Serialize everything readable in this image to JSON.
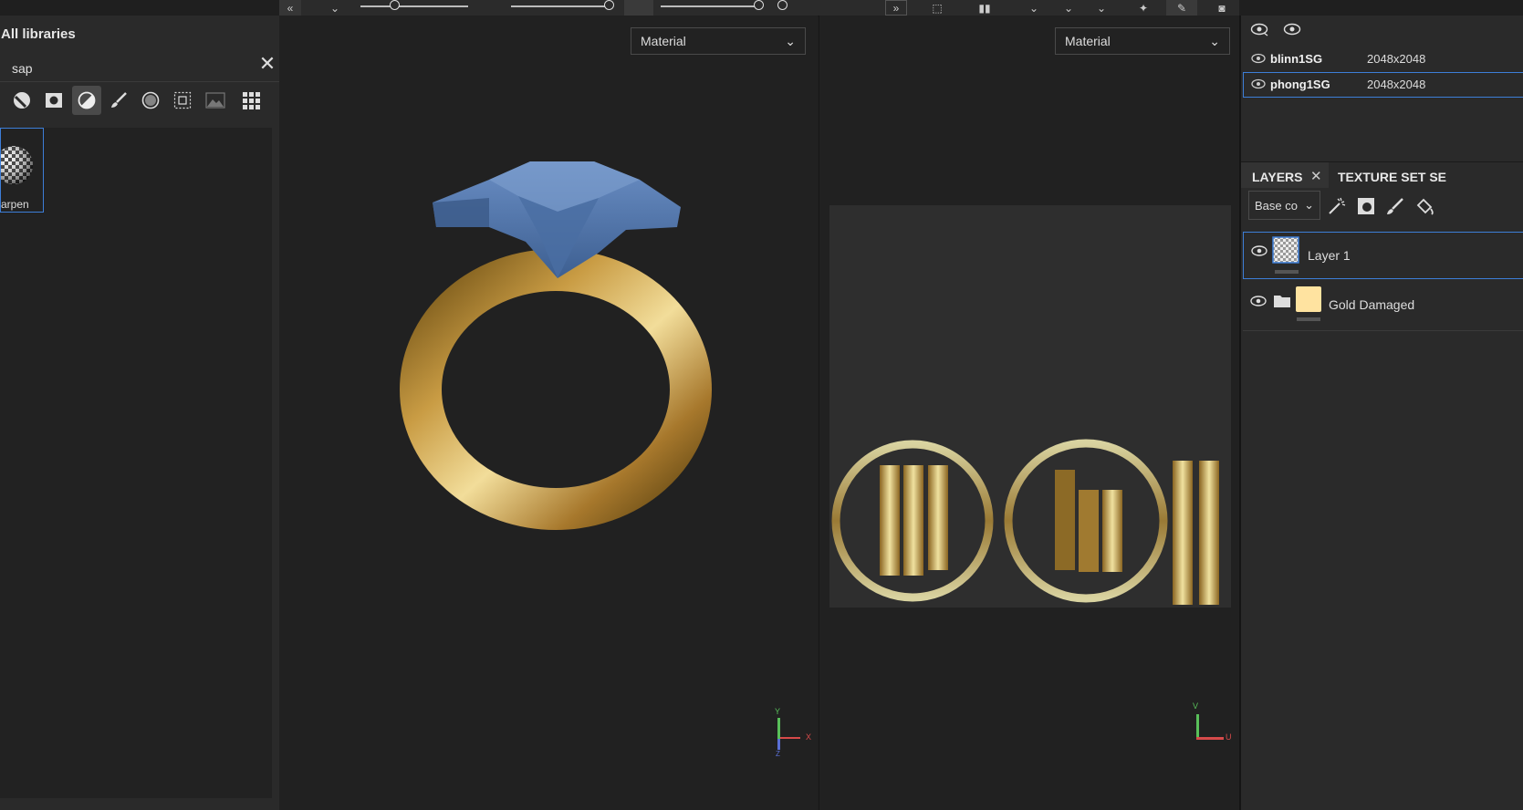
{
  "libraries": {
    "title": "All libraries",
    "search_value": "sap",
    "asset_label": "arpen",
    "filters": [
      "smart-materials-icon",
      "mask-icon",
      "materials-icon",
      "brushes-icon",
      "alphas-icon",
      "procedurals-icon",
      "textures-icon",
      "all-icon"
    ],
    "active_filter": 2
  },
  "viewport3d": {
    "channel_select": "Material",
    "axis_y": "Y",
    "axis_x": "X",
    "axis_z": "Z"
  },
  "viewport2d": {
    "channel_select": "Material",
    "axis_v": "V",
    "axis_u": "U"
  },
  "texture_sets": {
    "rows": [
      {
        "name": "blinn1SG",
        "resolution": "2048x2048",
        "selected": false
      },
      {
        "name": "phong1SG",
        "resolution": "2048x2048",
        "selected": true
      }
    ]
  },
  "layers_panel": {
    "tab_layers": "LAYERS",
    "tab_texture_set": "TEXTURE SET SE",
    "channel_select": "Base co",
    "layers": [
      {
        "name": "Layer 1",
        "type": "paint",
        "selected": true
      },
      {
        "name": "Gold Damaged",
        "type": "folder",
        "selected": false,
        "swatch": "#ffe3a0"
      }
    ]
  },
  "colors": {
    "accent": "#3d7ed8",
    "gem": "#4f74a8",
    "gold": "#b8923a"
  }
}
